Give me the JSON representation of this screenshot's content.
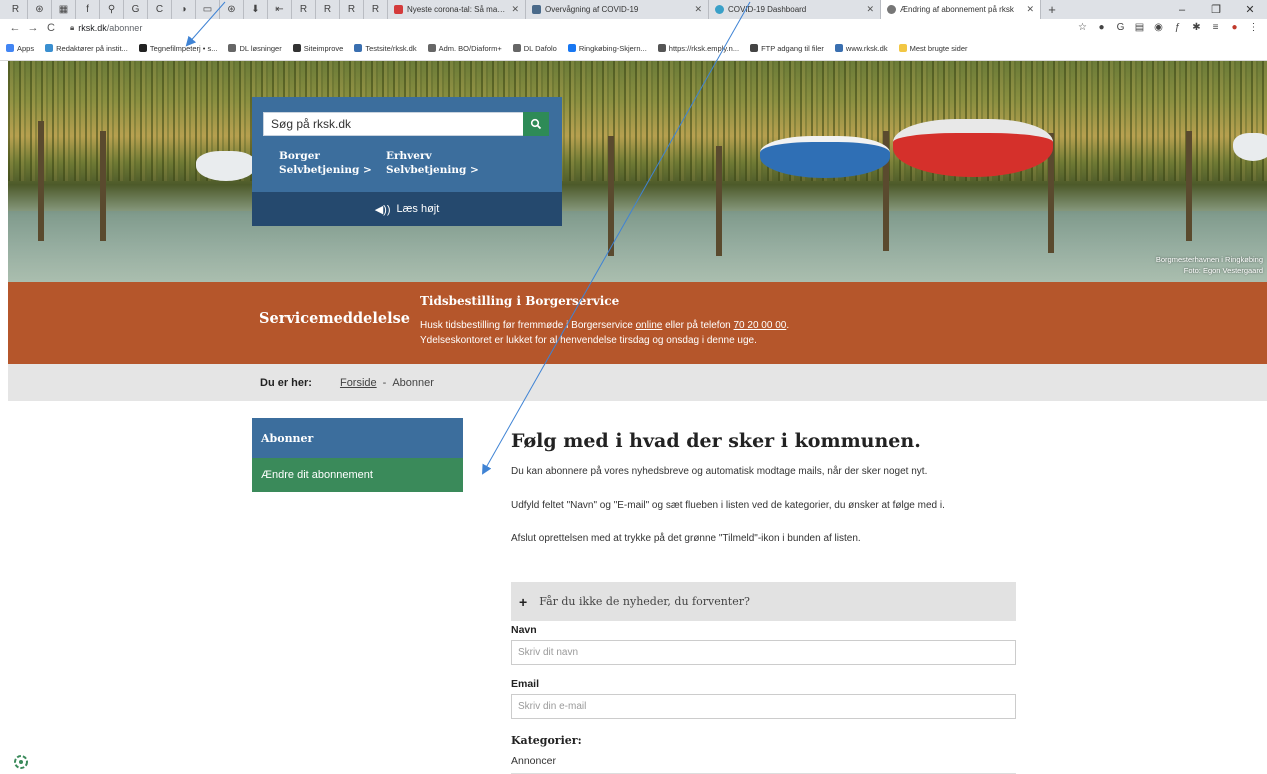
{
  "browser": {
    "pinned_tabs": [
      "R",
      "⊛",
      "▦",
      "f",
      "⚲",
      "G",
      "C",
      "◑",
      "▭",
      "⊛",
      "⬇",
      "⇤",
      "R",
      "R",
      "R",
      "R"
    ],
    "tabs": [
      {
        "title": "Nyeste corona-tal: Så mange er",
        "color": "#d43b3b"
      },
      {
        "title": "Overvågning af COVID-19",
        "color": "#4a6a8a"
      },
      {
        "title": "COVID-19 Dashboard",
        "color": "#3aa0c8"
      },
      {
        "title": "Ændring af abonnement på rksk",
        "color": "#777777"
      }
    ],
    "new_tab": "+",
    "window_controls": [
      "–",
      "❐",
      "✕"
    ],
    "url_host": "rksk.dk",
    "url_path": "/abonner",
    "bookmarks": [
      {
        "label": "Apps",
        "color": "#4285f4"
      },
      {
        "label": "Redaktører på instit...",
        "color": "#3a8fd0"
      },
      {
        "label": "Tegnefilmpeterj • s...",
        "color": "#222222"
      },
      {
        "label": "DL løsninger",
        "color": "#666666"
      },
      {
        "label": "Siteimprove",
        "color": "#333333"
      },
      {
        "label": "Testsite/rksk.dk",
        "color": "#3a6fb0"
      },
      {
        "label": "Adm. BO/Diaform+",
        "color": "#666666"
      },
      {
        "label": "DL Dafolo",
        "color": "#666666"
      },
      {
        "label": "Ringkøbing-Skjern...",
        "color": "#1877f2"
      },
      {
        "label": "https://rksk.emply.n...",
        "color": "#555555"
      },
      {
        "label": "FTP adgang til filer",
        "color": "#444444"
      },
      {
        "label": "www.rksk.dk",
        "color": "#3a6fb0"
      },
      {
        "label": "Mest brugte sider",
        "color": "#f2c744"
      }
    ]
  },
  "hero": {
    "search_placeholder": "Søg på rksk.dk",
    "links": [
      {
        "line1": "Borger",
        "line2": "Selvbetjening >"
      },
      {
        "line1": "Erhverv",
        "line2": "Selvbetjening >"
      }
    ],
    "listen": "Læs højt",
    "caption_line1": "Borgmesterhavnen i Ringkøbing",
    "caption_line2": "Foto: Egon Vestergaard"
  },
  "notice": {
    "label": "Servicemeddelelse",
    "title": "Tidsbestilling i Borgerservice",
    "line1_pre": "Husk tidsbestilling før fremmøde i Borgerservice ",
    "line1_link": "online",
    "line1_mid": " eller på telefon ",
    "line1_phone": "70 20 00 00",
    "line1_end": ".",
    "line2": "Ydelseskontoret er lukket for al henvendelse tirsdag og onsdag i denne uge."
  },
  "breadcrumb": {
    "label": "Du er her:",
    "home": "Forside",
    "separator": "-",
    "current": "Abonner"
  },
  "sidebar": {
    "items": [
      {
        "label": "Abonner"
      },
      {
        "label": "Ændre dit abonnement"
      }
    ]
  },
  "main": {
    "heading": "Følg med i hvad der sker i kommunen.",
    "p1": "Du kan abonnere på vores nyhedsbreve og automatisk modtage mails, når der sker noget nyt.",
    "p2": "Udfyld feltet \"Navn\" og \"E-mail\" og sæt flueben i listen ved de kategorier, du ønsker at følge med i.",
    "p3": "Afslut oprettelsen med at trykke på det grønne \"Tilmeld\"-ikon i bunden af listen.",
    "faq": "Får du ikke de nyheder, du forventer?",
    "name_label": "Navn",
    "name_placeholder": "Skriv dit navn",
    "email_label": "Email",
    "email_placeholder": "Skriv din e-mail",
    "categories_label": "Kategorier:",
    "categories": [
      "Annoncer"
    ]
  },
  "colors": {
    "primary_blue": "#3c6e9d",
    "dark_blue": "#25496e",
    "green": "#3a8a5a",
    "notice_orange": "#b5562b",
    "annotation_arrow": "#3f83d4"
  }
}
